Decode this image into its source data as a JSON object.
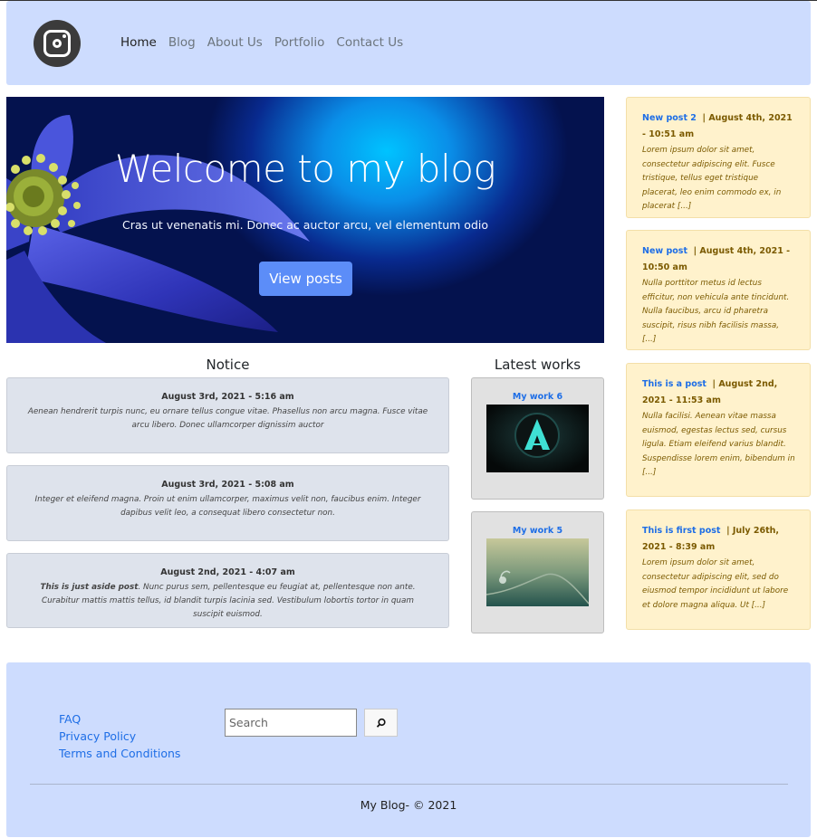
{
  "header": {
    "nav": [
      "Home",
      "Blog",
      "About Us",
      "Portfolio",
      "Contact Us"
    ]
  },
  "hero": {
    "title": "Welcome to my blog",
    "subtitle": "Cras ut venenatis mi. Donec ac auctor arcu, vel elementum odio",
    "button": "View posts"
  },
  "notice": {
    "heading": "Notice",
    "items": [
      {
        "date": "August 3rd, 2021 - 5:16 am",
        "bold": "",
        "text": "Aenean hendrerit turpis nunc, eu ornare tellus congue vitae. Phasellus non arcu magna. Fusce vitae arcu libero. Donec ullamcorper dignissim auctor"
      },
      {
        "date": "August 3rd, 2021 - 5:08 am",
        "bold": "",
        "text": "Integer et eleifend magna. Proin ut enim ullamcorper, maximus velit non, faucibus enim. Integer dapibus velit leo, a consequat libero consectetur non."
      },
      {
        "date": "August 2nd, 2021 - 4:07 am",
        "bold": "This is just aside post",
        "text": ". Nunc purus sem, pellentesque eu feugiat at, pellentesque non ante. Curabitur mattis mattis tellus, id blandit turpis lacinia sed. Vestibulum lobortis tortor in quam suscipit euismod."
      }
    ]
  },
  "works": {
    "heading": "Latest works",
    "items": [
      {
        "title": "My work 6",
        "image": "assassins-creed-logo"
      },
      {
        "title": "My work 5",
        "image": "water-droplet-plant"
      }
    ]
  },
  "posts": [
    {
      "title": "New post 2",
      "date": "|  August 4th, 2021 - 10:51 am",
      "excerpt": "Lorem ipsum dolor sit amet, consectetur adipiscing elit. Fusce tristique, tellus eget tristique placerat, leo enim commodo ex, in placerat [...]"
    },
    {
      "title": "New post",
      "date": "|  August 4th, 2021 - 10:50 am",
      "excerpt": "Nulla porttitor metus id lectus efficitur, non vehicula ante tincidunt. Nulla faucibus, arcu id pharetra suscipit, risus nibh facilisis massa, [...]"
    },
    {
      "title": "This is a post",
      "date": "|  August 2nd, 2021 - 11:53 am",
      "excerpt": "Nulla facilisi. Aenean vitae massa euismod, egestas lectus sed, cursus ligula. Etiam eleifend varius blandit. Suspendisse lorem enim, bibendum in [...]"
    },
    {
      "title": "This is first post",
      "date": "|  July 26th, 2021 - 8:39 am",
      "excerpt": "Lorem ipsum dolor sit amet, consectetur adipiscing elit, sed do eiusmod tempor incididunt ut labore et dolore magna aliqua. Ut [...]"
    }
  ],
  "footer": {
    "links": [
      "FAQ",
      "Privacy Policy",
      "Terms and Conditions"
    ],
    "search_placeholder": "Search",
    "copyright": "My Blog- © 2021"
  },
  "colors": {
    "header_bg": "#cddcfe",
    "link": "#1e6ee6",
    "post_bg": "#fff2cc",
    "notice_bg": "#dee3ec",
    "button": "#5c8df8"
  },
  "icons": {
    "logo": "instagram-icon",
    "search": "search-icon"
  }
}
